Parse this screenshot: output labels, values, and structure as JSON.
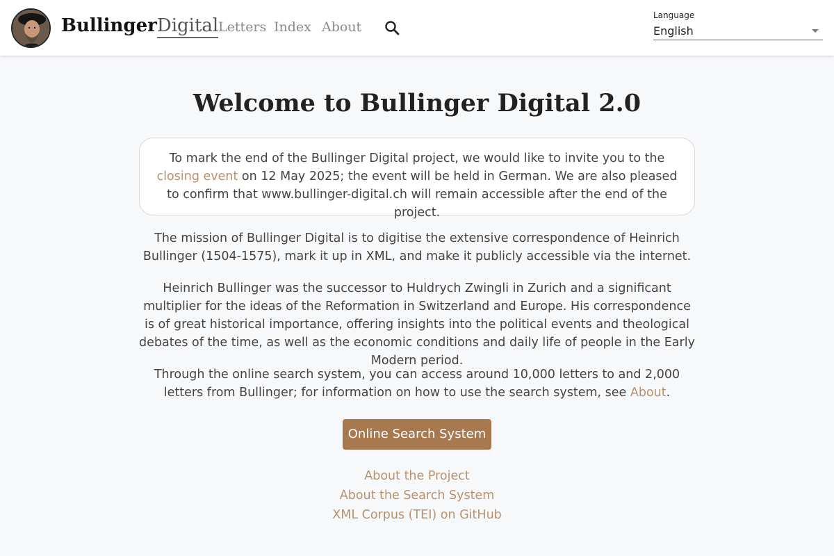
{
  "header": {
    "logo_bold": "Bullinger",
    "logo_light": "Digital",
    "nav": [
      "Letters",
      "Index",
      "About"
    ],
    "language": {
      "label": "Language",
      "value": "English"
    }
  },
  "main": {
    "title": "Welcome to Bullinger Digital 2.0",
    "notice": {
      "text_before": "To mark the end of the Bullinger Digital project, we would like to invite you to the ",
      "link": "closing event",
      "text_after": " on 12 May 2025; the event will be held in German. We are also pleased to confirm that www.bullinger-digital.ch will remain accessible after the end of the project."
    },
    "paragraphs": [
      "The mission of Bullinger Digital is to digitise the extensive correspondence of Heinrich Bullinger (1504-1575), mark it up in XML, and make it publicly accessible via the internet.",
      "Heinrich Bullinger was the successor to Huldrych Zwingli in Zurich and a significant multiplier for the ideas of the Reformation in Switzerland and Europe. His correspondence is of great historical importance, offering insights into the political events and theological debates of the time, as well as the economic conditions and daily life of people in the Early Modern period."
    ],
    "search_para": {
      "text_before": "Through the online search system, you can access around 10,000 letters to and 2,000 letters from Bullinger; for information on how to use the search system, see ",
      "link": "About",
      "text_after": "."
    },
    "cta_label": "Online Search System",
    "links": [
      "About the Project",
      "About the Search System",
      "XML Corpus (TEI) on GitHub"
    ]
  },
  "colors": {
    "accent": "#a8784f",
    "link": "#b8916a",
    "background": "#f7f8fa"
  }
}
